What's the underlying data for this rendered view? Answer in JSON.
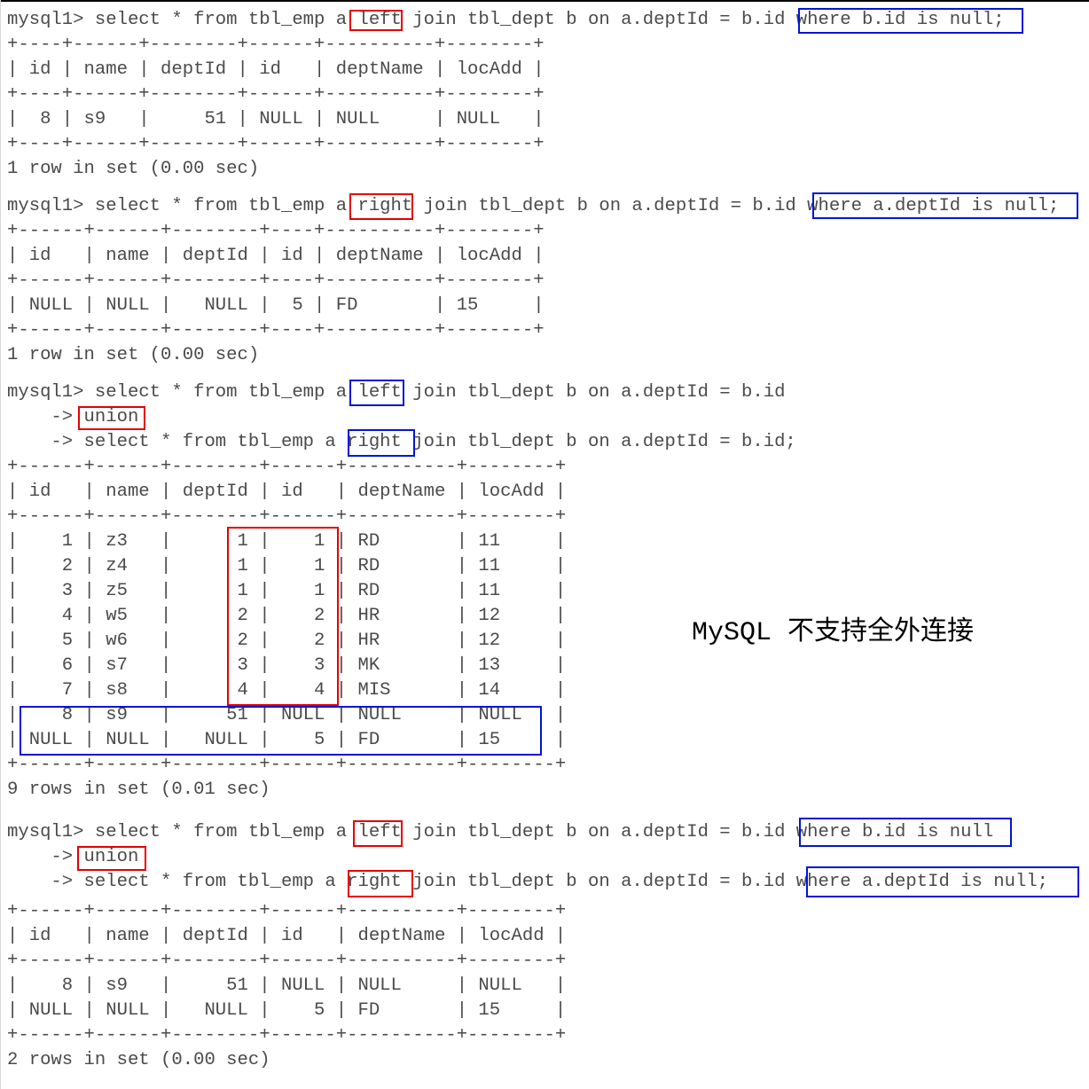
{
  "annotation": {
    "prefix": "MySQL ",
    "text": "不支持全外连接"
  },
  "colors": {
    "text": "#4a4a4a",
    "highlight_red": "#e60000",
    "highlight_blue": "#0014d6"
  },
  "blocks": [
    {
      "lines": [
        "mysql1> select * from tbl_emp a left join tbl_dept b on a.deptId = b.id where b.id is null;",
        "+----+------+--------+------+----------+--------+",
        "| id | name | deptId | id   | deptName | locAdd |",
        "+----+------+--------+------+----------+--------+",
        "|  8 | s9   |     51 | NULL | NULL     | NULL   |",
        "+----+------+--------+------+----------+--------+",
        "1 row in set (0.00 sec)"
      ]
    },
    {
      "lines": [
        "mysql1> select * from tbl_emp a right join tbl_dept b on a.deptId = b.id where a.deptId is null;",
        "+------+------+--------+----+----------+--------+",
        "| id   | name | deptId | id | deptName | locAdd |",
        "+------+------+--------+----+----------+--------+",
        "| NULL | NULL |   NULL |  5 | FD       | 15     |",
        "+------+------+--------+----+----------+--------+",
        "1 row in set (0.00 sec)"
      ]
    },
    {
      "lines": [
        "mysql1> select * from tbl_emp a left join tbl_dept b on a.deptId = b.id",
        "    -> union",
        "    -> select * from tbl_emp a right join tbl_dept b on a.deptId = b.id;",
        "+------+------+--------+------+----------+--------+",
        "| id   | name | deptId | id   | deptName | locAdd |",
        "+------+------+--------+------+----------+--------+",
        "|    1 | z3   |      1 |    1 | RD       | 11     |",
        "|    2 | z4   |      1 |    1 | RD       | 11     |",
        "|    3 | z5   |      1 |    1 | RD       | 11     |",
        "|    4 | w5   |      2 |    2 | HR       | 12     |",
        "|    5 | w6   |      2 |    2 | HR       | 12     |",
        "|    6 | s7   |      3 |    3 | MK       | 13     |",
        "|    7 | s8   |      4 |    4 | MIS      | 14     |",
        "|    8 | s9   |     51 | NULL | NULL     | NULL   |",
        "| NULL | NULL |   NULL |    5 | FD       | 15     |",
        "+------+------+--------+------+----------+--------+",
        "9 rows in set (0.01 sec)"
      ]
    },
    {
      "lines": [
        "mysql1> select * from tbl_emp a left join tbl_dept b on a.deptId = b.id where b.id is null",
        "    -> union",
        "    -> select * from tbl_emp a right join tbl_dept b on a.deptId = b.id where a.deptId is null;",
        "+------+------+--------+------+----------+--------+",
        "| id   | name | deptId | id   | deptName | locAdd |",
        "+------+------+--------+------+----------+--------+",
        "|    8 | s9   |     51 | NULL | NULL     | NULL   |",
        "| NULL | NULL |   NULL |    5 | FD       | 15     |",
        "+------+------+--------+------+----------+--------+",
        "2 rows in set (0.00 sec)"
      ]
    }
  ]
}
